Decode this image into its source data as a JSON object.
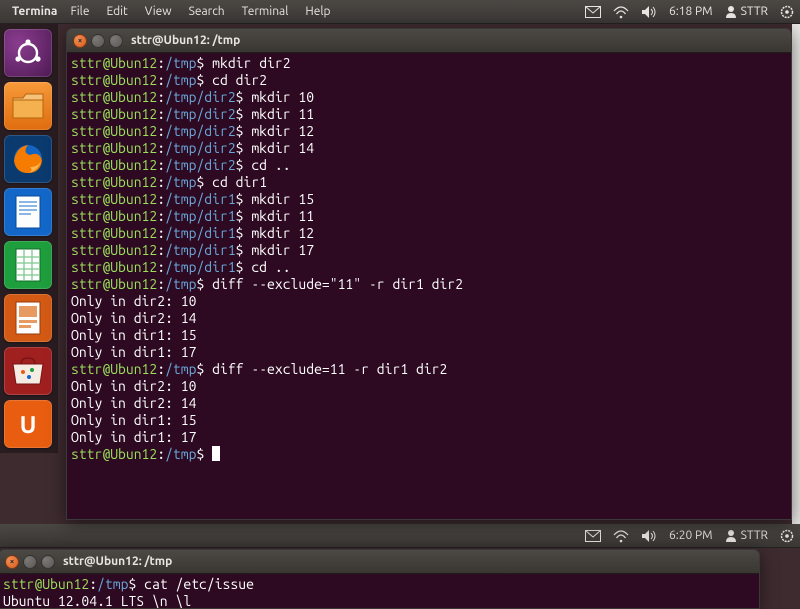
{
  "panel1": {
    "app_label": "Termina",
    "menu": [
      "File",
      "Edit",
      "View",
      "Search",
      "Terminal",
      "Help"
    ],
    "clock": "6:18 PM",
    "user": "STTR"
  },
  "panel2": {
    "clock": "6:20 PM",
    "user": "STTR"
  },
  "launcher_items": [
    {
      "name": "dash",
      "glyph": ""
    },
    {
      "name": "files",
      "glyph": ""
    },
    {
      "name": "firefox",
      "glyph": ""
    },
    {
      "name": "writer",
      "glyph": ""
    },
    {
      "name": "calc",
      "glyph": ""
    },
    {
      "name": "impress",
      "glyph": ""
    },
    {
      "name": "usc",
      "glyph": ""
    },
    {
      "name": "ubuntu-one",
      "glyph": "U"
    }
  ],
  "term1": {
    "title": "sttr@Ubun12: /tmp",
    "lines": [
      {
        "user": "sttr@Ubun12",
        "path": "/tmp",
        "cmd": "mkdir dir2"
      },
      {
        "user": "sttr@Ubun12",
        "path": "/tmp",
        "cmd": "cd dir2"
      },
      {
        "user": "sttr@Ubun12",
        "path": "/tmp/dir2",
        "cmd": "mkdir 10"
      },
      {
        "user": "sttr@Ubun12",
        "path": "/tmp/dir2",
        "cmd": "mkdir 11"
      },
      {
        "user": "sttr@Ubun12",
        "path": "/tmp/dir2",
        "cmd": "mkdir 12"
      },
      {
        "user": "sttr@Ubun12",
        "path": "/tmp/dir2",
        "cmd": "mkdir 14"
      },
      {
        "user": "sttr@Ubun12",
        "path": "/tmp/dir2",
        "cmd": "cd .."
      },
      {
        "user": "sttr@Ubun12",
        "path": "/tmp",
        "cmd": "cd dir1"
      },
      {
        "user": "sttr@Ubun12",
        "path": "/tmp/dir1",
        "cmd": "mkdir 15"
      },
      {
        "user": "sttr@Ubun12",
        "path": "/tmp/dir1",
        "cmd": "mkdir 11"
      },
      {
        "user": "sttr@Ubun12",
        "path": "/tmp/dir1",
        "cmd": "mkdir 12"
      },
      {
        "user": "sttr@Ubun12",
        "path": "/tmp/dir1",
        "cmd": "mkdir 17"
      },
      {
        "user": "sttr@Ubun12",
        "path": "/tmp/dir1",
        "cmd": "cd .."
      },
      {
        "user": "sttr@Ubun12",
        "path": "/tmp",
        "cmd": "diff --exclude=\"11\" -r dir1 dir2"
      },
      {
        "out": "Only in dir2: 10"
      },
      {
        "out": "Only in dir2: 14"
      },
      {
        "out": "Only in dir1: 15"
      },
      {
        "out": "Only in dir1: 17"
      },
      {
        "user": "sttr@Ubun12",
        "path": "/tmp",
        "cmd": "diff --exclude=11 -r dir1 dir2"
      },
      {
        "out": "Only in dir2: 10"
      },
      {
        "out": "Only in dir2: 14"
      },
      {
        "out": "Only in dir1: 15"
      },
      {
        "out": "Only in dir1: 17"
      },
      {
        "user": "sttr@Ubun12",
        "path": "/tmp",
        "cmd": "",
        "cursor": true
      }
    ]
  },
  "term2": {
    "title": "sttr@Ubun12: /tmp",
    "lines": [
      {
        "user": "sttr@Ubun12",
        "path": "/tmp",
        "cmd": "cat /etc/issue"
      },
      {
        "out": "Ubuntu 12.04.1 LTS \\n \\l"
      }
    ]
  }
}
